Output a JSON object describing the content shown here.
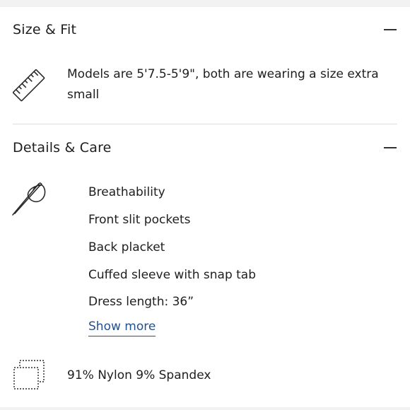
{
  "size_fit": {
    "title": "Size & Fit",
    "toggle_icon": "minus-icon",
    "icon": "ruler-icon",
    "text": "Models are 5'7.5-5'9\", both are wearing a size extra small"
  },
  "details_care": {
    "title": "Details & Care",
    "toggle_icon": "minus-icon",
    "icon": "needle-thread-icon",
    "items": [
      "Breathability",
      "Front slit pockets",
      "Back placket",
      "Cuffed sleeve with snap tab",
      "Dress length: 36”"
    ],
    "show_more": "Show more"
  },
  "fabric": {
    "icon": "fabric-swatch-icon",
    "text": "91% Nylon 9% Spandex"
  }
}
